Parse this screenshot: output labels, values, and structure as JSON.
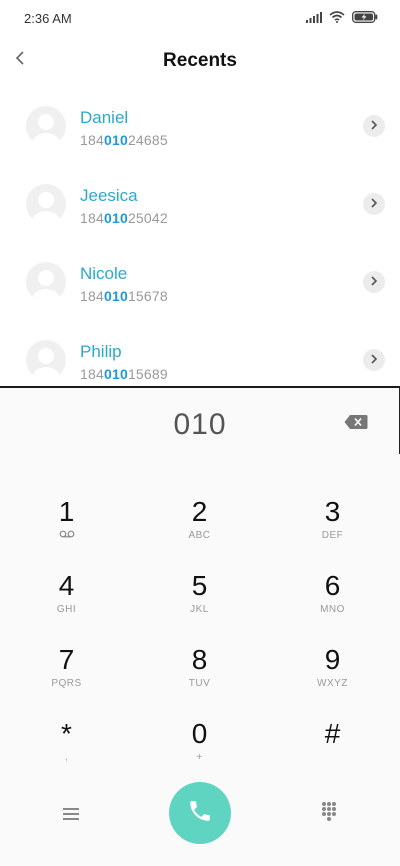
{
  "status_bar": {
    "time": "2:36 AM",
    "icons": [
      "signal-icon",
      "wifi-icon",
      "battery-charging-icon"
    ]
  },
  "header": {
    "title": "Recents",
    "back_icon": "chevron-left-icon"
  },
  "contacts": [
    {
      "name": "Daniel",
      "number_prefix": "184",
      "number_match": "010",
      "number_suffix": "24685"
    },
    {
      "name": "Jeesica",
      "number_prefix": "184",
      "number_match": "010",
      "number_suffix": "25042"
    },
    {
      "name": "Nicole",
      "number_prefix": "184",
      "number_match": "010",
      "number_suffix": "15678"
    },
    {
      "name": "Philip",
      "number_prefix": "184",
      "number_match": "010",
      "number_suffix": "15689"
    }
  ],
  "dialer": {
    "input_value": "010",
    "backspace_icon": "backspace-icon"
  },
  "keypad": [
    {
      "digit": "1",
      "letters": "",
      "sub_icon": "voicemail-icon"
    },
    {
      "digit": "2",
      "letters": "ABC"
    },
    {
      "digit": "3",
      "letters": "DEF"
    },
    {
      "digit": "4",
      "letters": "GHI"
    },
    {
      "digit": "5",
      "letters": "JKL"
    },
    {
      "digit": "6",
      "letters": "MNO"
    },
    {
      "digit": "7",
      "letters": "PQRS"
    },
    {
      "digit": "8",
      "letters": "TUV"
    },
    {
      "digit": "9",
      "letters": "WXYZ"
    },
    {
      "digit": "*",
      "letters": ","
    },
    {
      "digit": "0",
      "letters": "+"
    },
    {
      "digit": "#",
      "letters": ""
    }
  ],
  "bottom_bar": {
    "menu_icon": "menu-icon",
    "call_icon": "phone-icon",
    "keypad_icon": "dialpad-grid-icon"
  },
  "colors": {
    "accent_name": "#2aaacc",
    "match_highlight": "#1e9bd4",
    "call_button": "#5fd4c0"
  }
}
